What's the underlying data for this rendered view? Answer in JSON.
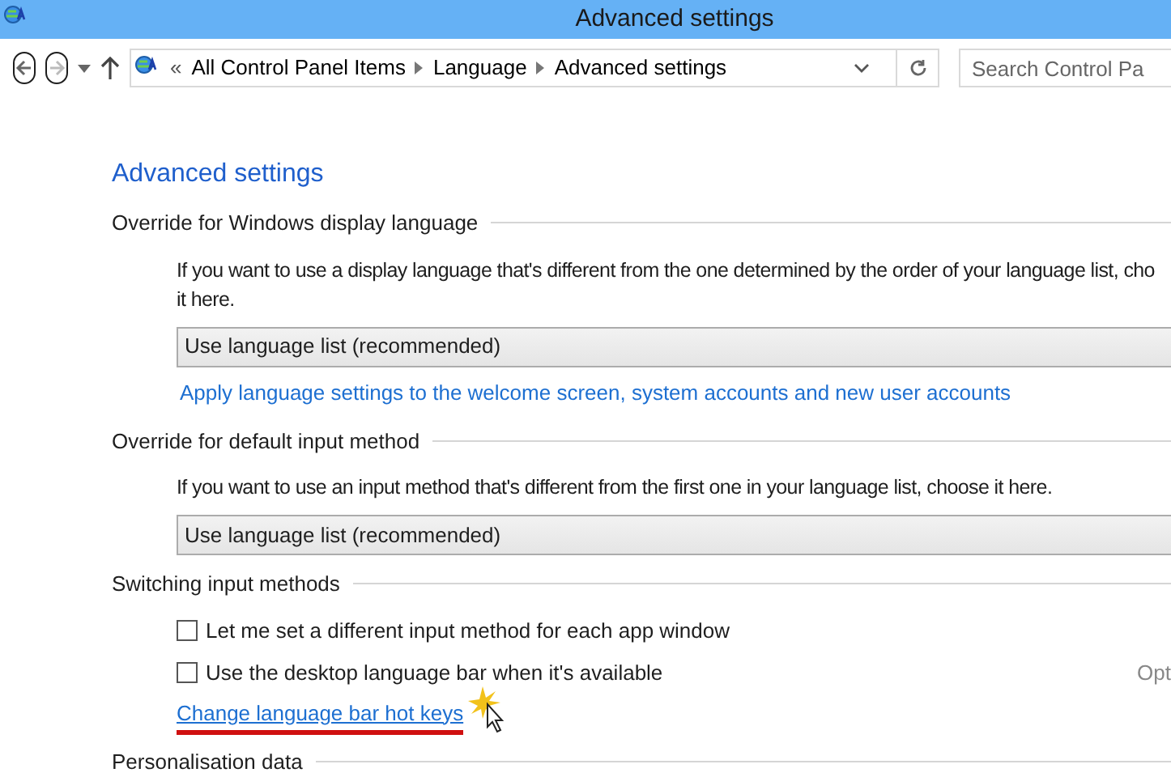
{
  "window": {
    "title": "Advanced settings"
  },
  "address_bar": {
    "prefix": "«",
    "crumbs": [
      "All Control Panel Items",
      "Language",
      "Advanced settings"
    ],
    "search_placeholder": "Search Control Pa"
  },
  "heading": "Advanced settings",
  "sections": [
    {
      "kind": "dropdown",
      "title": "Override for Windows display language",
      "description_lines": [
        "If you want to use a display language that's different from the one determined by the order of your language list, cho",
        "it here."
      ],
      "dropdown": {
        "value": "Use language list (recommended)"
      },
      "link": "Apply language settings to the welcome screen, system accounts and new user accounts"
    },
    {
      "kind": "dropdown",
      "title": "Override for default input method",
      "description": "If you want to use an input method that's different from the first one in your language list, choose it here.",
      "dropdown": {
        "value": "Use language list (recommended)"
      }
    },
    {
      "kind": "checkboxes",
      "title": "Switching input methods",
      "options": [
        {
          "label": "Let me set a different input method for each app window",
          "checked": false
        },
        {
          "label": "Use the desktop language bar when it's available",
          "checked": false,
          "side_link": "Opt"
        }
      ],
      "link": "Change language bar hot keys",
      "link_underlined": true
    },
    {
      "kind": "header",
      "title": "Personalisation data"
    }
  ]
}
